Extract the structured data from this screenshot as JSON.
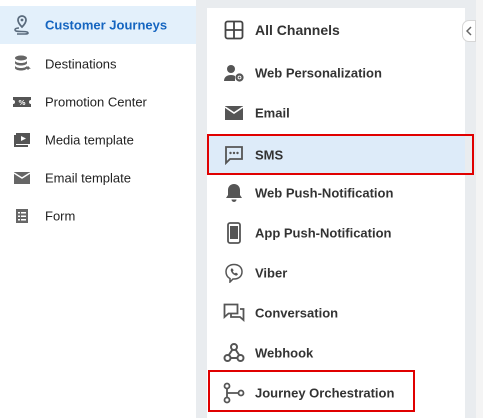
{
  "sidebar": {
    "items": [
      {
        "label": "Customer Journeys",
        "icon": "journey-pin-icon",
        "active": true
      },
      {
        "label": "Destinations",
        "icon": "database-icon"
      },
      {
        "label": "Promotion Center",
        "icon": "ticket-icon"
      },
      {
        "label": "Media template",
        "icon": "media-template-icon"
      },
      {
        "label": "Email template",
        "icon": "envelope-icon"
      },
      {
        "label": "Form",
        "icon": "form-icon"
      }
    ]
  },
  "channels": {
    "header": {
      "label": "All Channels",
      "icon": "grid-icon"
    },
    "items": [
      {
        "label": "Web Personalization",
        "icon": "user-gear-icon"
      },
      {
        "label": "Email",
        "icon": "email-icon"
      },
      {
        "label": "SMS",
        "icon": "sms-icon",
        "selected": true
      },
      {
        "label": "Web Push-Notification",
        "icon": "bell-icon"
      },
      {
        "label": "App Push-Notification",
        "icon": "mobile-icon"
      },
      {
        "label": "Viber",
        "icon": "viber-icon"
      },
      {
        "label": "Conversation",
        "icon": "conversation-icon"
      },
      {
        "label": "Webhook",
        "icon": "webhook-icon"
      },
      {
        "label": "Journey Orchestration",
        "icon": "orchestration-icon"
      }
    ]
  },
  "colors": {
    "active_bg": "#e3f0fb",
    "active_text": "#1565c0",
    "selected_bg": "#ddebf9",
    "highlight_border": "#e00000",
    "icon": "#555555"
  }
}
